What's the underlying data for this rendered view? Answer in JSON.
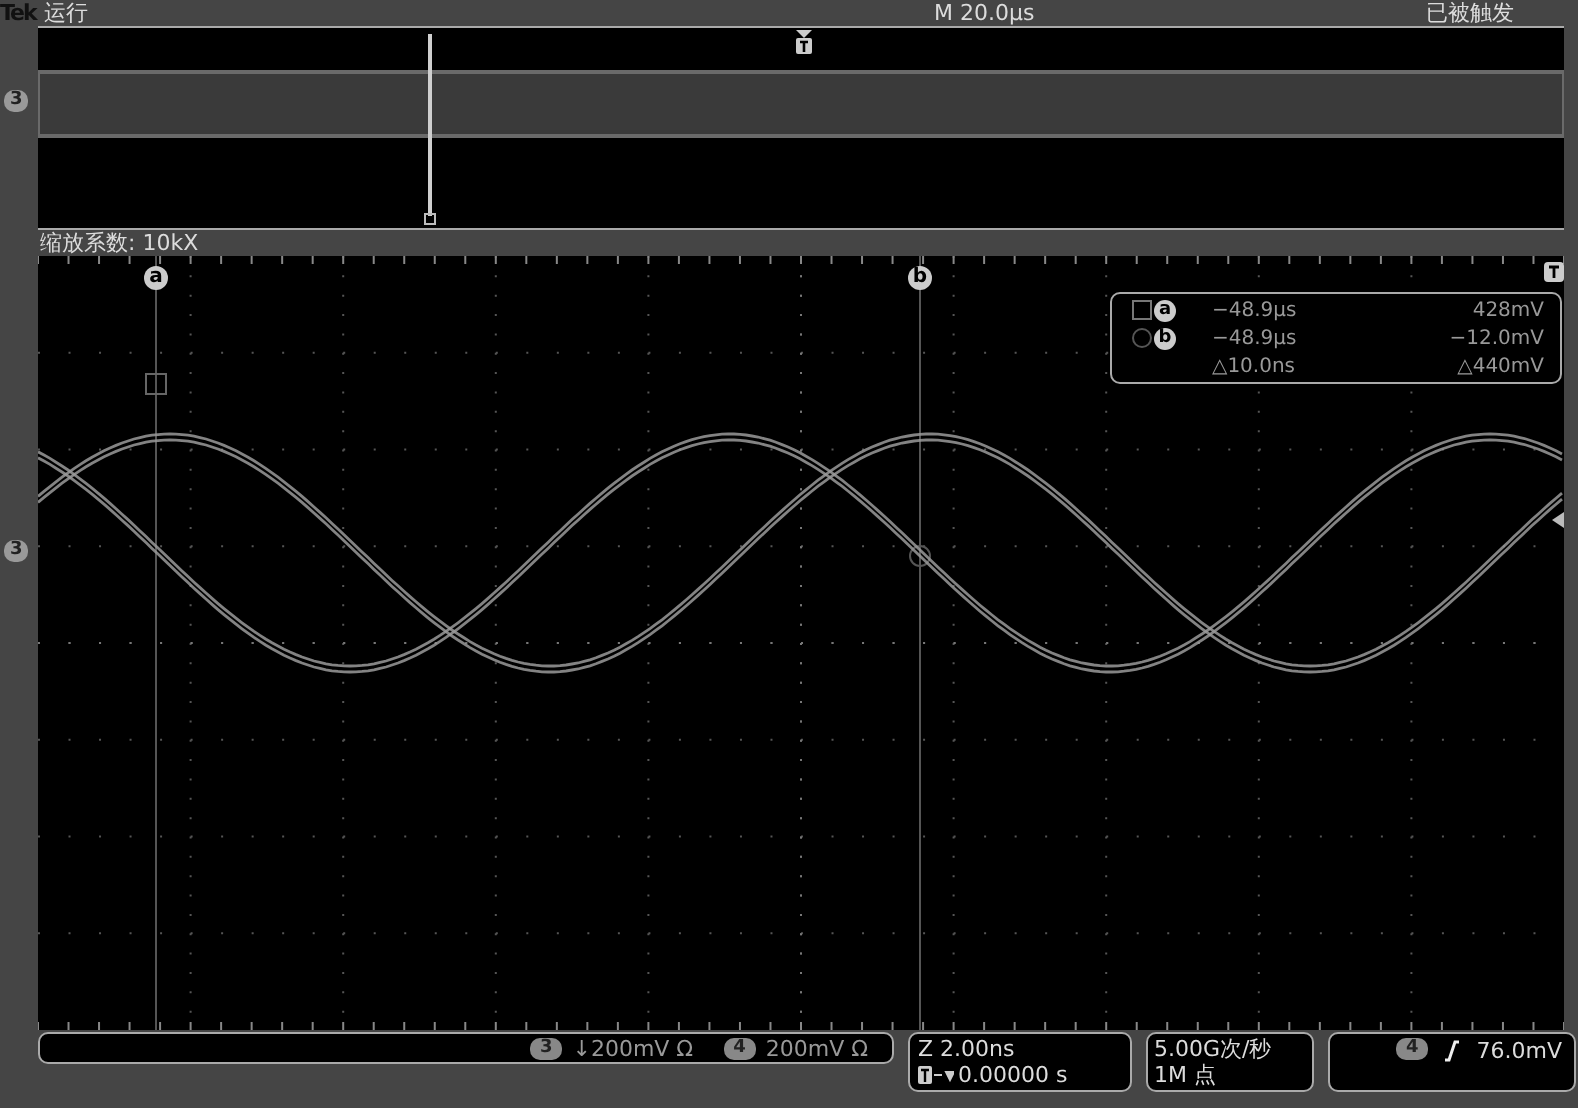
{
  "top_bar": {
    "brand": "Tek",
    "run_state": "运行",
    "timebase": "M 20.0µs",
    "trigger_state": "已被触发"
  },
  "overview": {
    "channel_marker": "3"
  },
  "zoom_label": "缩放系数: 10kX",
  "graticule": {
    "channel_marker": "3",
    "cursors": [
      {
        "label": "a"
      },
      {
        "label": "b"
      }
    ],
    "readout": {
      "rows": [
        {
          "marker": "a",
          "time": "−48.9µs",
          "value": "428mV"
        },
        {
          "marker": "b",
          "time": "−48.9µs",
          "value": "−12.0mV"
        }
      ],
      "delta_time": "△10.0ns",
      "delta_value": "△440mV"
    }
  },
  "bottom_bar": {
    "channels": [
      {
        "number": "3",
        "scale": "↓200mV Ω"
      },
      {
        "number": "4",
        "scale": "200mV Ω"
      }
    ],
    "zoom": {
      "scale": "Z 2.00ns",
      "position": "0.00000 s"
    },
    "acquisition": {
      "rate": "5.00G次/秒",
      "record": "1M 点"
    },
    "trigger": {
      "channel": "4",
      "level": "76.0mV"
    }
  }
}
